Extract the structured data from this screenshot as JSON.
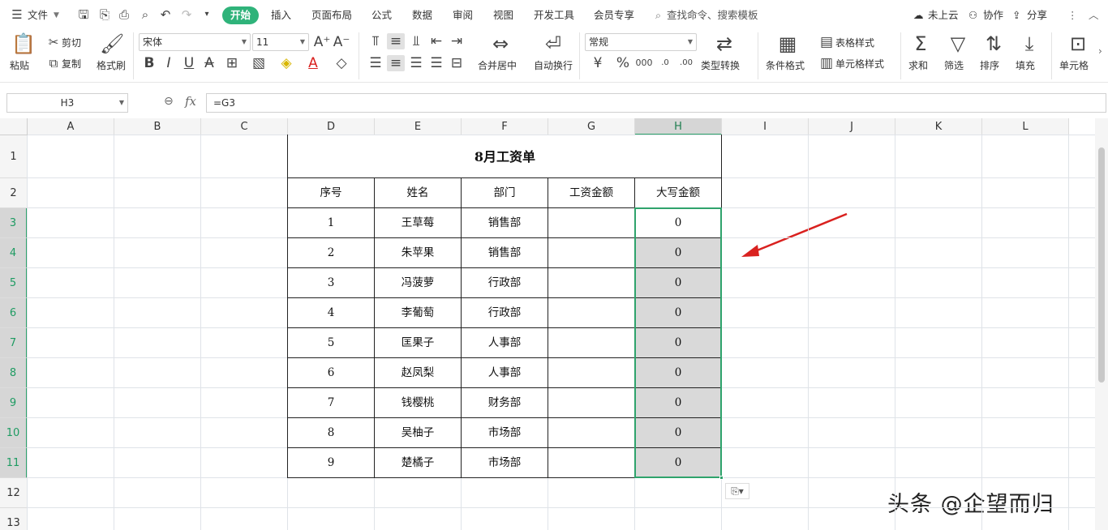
{
  "menubar": {
    "file": "文件",
    "tabs": [
      "开始",
      "插入",
      "页面布局",
      "公式",
      "数据",
      "审阅",
      "视图",
      "开发工具",
      "会员专享"
    ],
    "search": "查找命令、搜索模板",
    "cloud": "未上云",
    "collab": "协作",
    "share": "分享"
  },
  "ribbon": {
    "paste": "粘贴",
    "cut": "剪切",
    "copy": "复制",
    "format_painter": "格式刷",
    "font_name": "宋体",
    "font_size": "11",
    "number_format": "常规",
    "merge_center": "合并居中",
    "wrap": "自动换行",
    "type_convert": "类型转换",
    "cond_format": "条件格式",
    "table_style": "表格样式",
    "cell_style": "单元格样式",
    "sum": "求和",
    "filter": "筛选",
    "sort": "排序",
    "fill": "填充",
    "cell": "单元格"
  },
  "formula_bar": {
    "name_box": "H3",
    "fx": "fx",
    "formula": "=G3"
  },
  "columns": [
    "A",
    "B",
    "C",
    "D",
    "E",
    "F",
    "G",
    "H",
    "I",
    "J",
    "K",
    "L"
  ],
  "rows": [
    "1",
    "2",
    "3",
    "4",
    "5",
    "6",
    "7",
    "8",
    "9",
    "10",
    "11",
    "12",
    "13"
  ],
  "sheet": {
    "title": "8月工资单",
    "headers": [
      "序号",
      "姓名",
      "部门",
      "工资金额",
      "大写金额"
    ],
    "records": [
      {
        "no": "1",
        "name": "王草莓",
        "dept": "销售部",
        "salary": "",
        "upper": "0"
      },
      {
        "no": "2",
        "name": "朱苹果",
        "dept": "销售部",
        "salary": "",
        "upper": "0"
      },
      {
        "no": "3",
        "name": "冯菠萝",
        "dept": "行政部",
        "salary": "",
        "upper": "0"
      },
      {
        "no": "4",
        "name": "李葡萄",
        "dept": "行政部",
        "salary": "",
        "upper": "0"
      },
      {
        "no": "5",
        "name": "匡果子",
        "dept": "人事部",
        "salary": "",
        "upper": "0"
      },
      {
        "no": "6",
        "name": "赵凤梨",
        "dept": "人事部",
        "salary": "",
        "upper": "0"
      },
      {
        "no": "7",
        "name": "钱樱桃",
        "dept": "财务部",
        "salary": "",
        "upper": "0"
      },
      {
        "no": "8",
        "name": "吴柚子",
        "dept": "市场部",
        "salary": "",
        "upper": "0"
      },
      {
        "no": "9",
        "name": "楚橘子",
        "dept": "市场部",
        "salary": "",
        "upper": "0"
      }
    ]
  },
  "watermark": "头条 @企望而归",
  "colors": {
    "accent": "#2fb37a",
    "selection": "#2fa36c",
    "arrow": "#d9211f"
  }
}
